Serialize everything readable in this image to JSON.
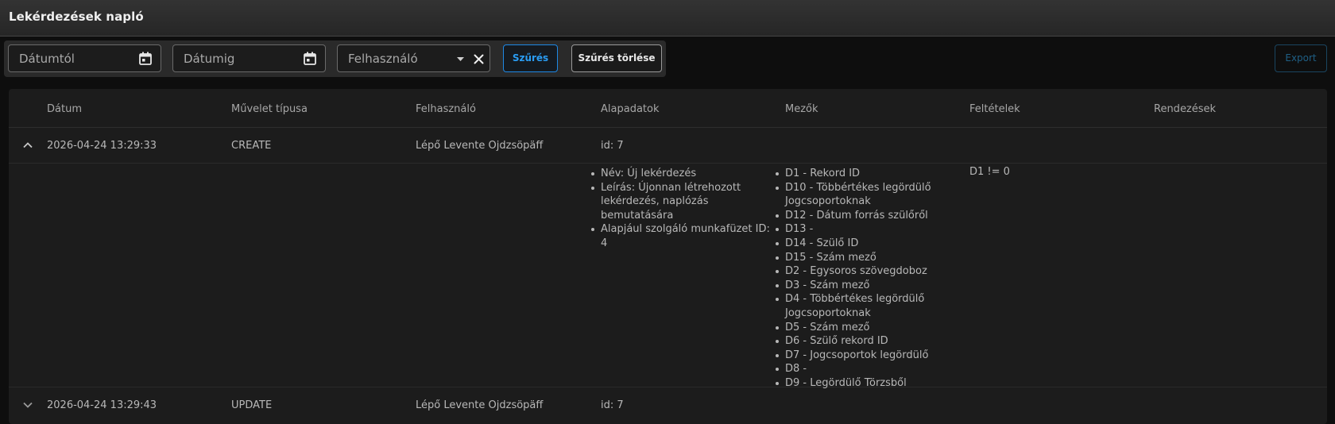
{
  "window": {
    "title": "Lekérdezések napló"
  },
  "filters": {
    "date_from_placeholder": "Dátumtól",
    "date_to_placeholder": "Dátumig",
    "user_placeholder": "Felhasználó",
    "filter_button": "Szűrés",
    "clear_button": "Szűrés törlése"
  },
  "export_button": "Export",
  "table": {
    "columns": [
      "Dátum",
      "Művelet típusa",
      "Felhasználó",
      "Alapadatok",
      "Mezők",
      "Feltételek",
      "Rendezések"
    ],
    "rows": [
      {
        "expanded": true,
        "date": "2026-04-24 13:29:33",
        "operation": "CREATE",
        "user": "Lépő Levente Ojdzsöpäff",
        "basic": "id: 7",
        "details": {
          "basic": [
            "Név: Új lekérdezés",
            "Leírás: Újonnan létrehozott lekérdezés, naplózás bemutatására",
            "Alapjául szolgáló munkafüzet ID: 4"
          ],
          "fields": [
            "D1 - Rekord ID",
            "D10 - Többértékes legördülő Jogcsoportoknak",
            "D12 - Dátum forrás szülőről",
            "D13 -",
            "D14 - Szülő ID",
            "D15 - Szám mező",
            "D2 - Egysoros szövegdoboz",
            "D3 - Szám mező",
            "D4 - Többértékes legördülő Jogcsoportoknak",
            "D5 - Szám mező",
            "D6 - Szülő rekord ID",
            "D7 - Jogcsoportok legördülő",
            "D8 -",
            "D9 - Legördülő Törzsből"
          ],
          "conditions": "D1 != 0"
        }
      },
      {
        "expanded": false,
        "date": "2026-04-24 13:29:43",
        "operation": "UPDATE",
        "user": "Lépő Levente Ojdzsöpäff",
        "basic": "id: 7"
      }
    ]
  },
  "colors": {
    "accent": "#1e88e5",
    "background": "#0e0e0e",
    "panel": "#1c1c1c"
  }
}
